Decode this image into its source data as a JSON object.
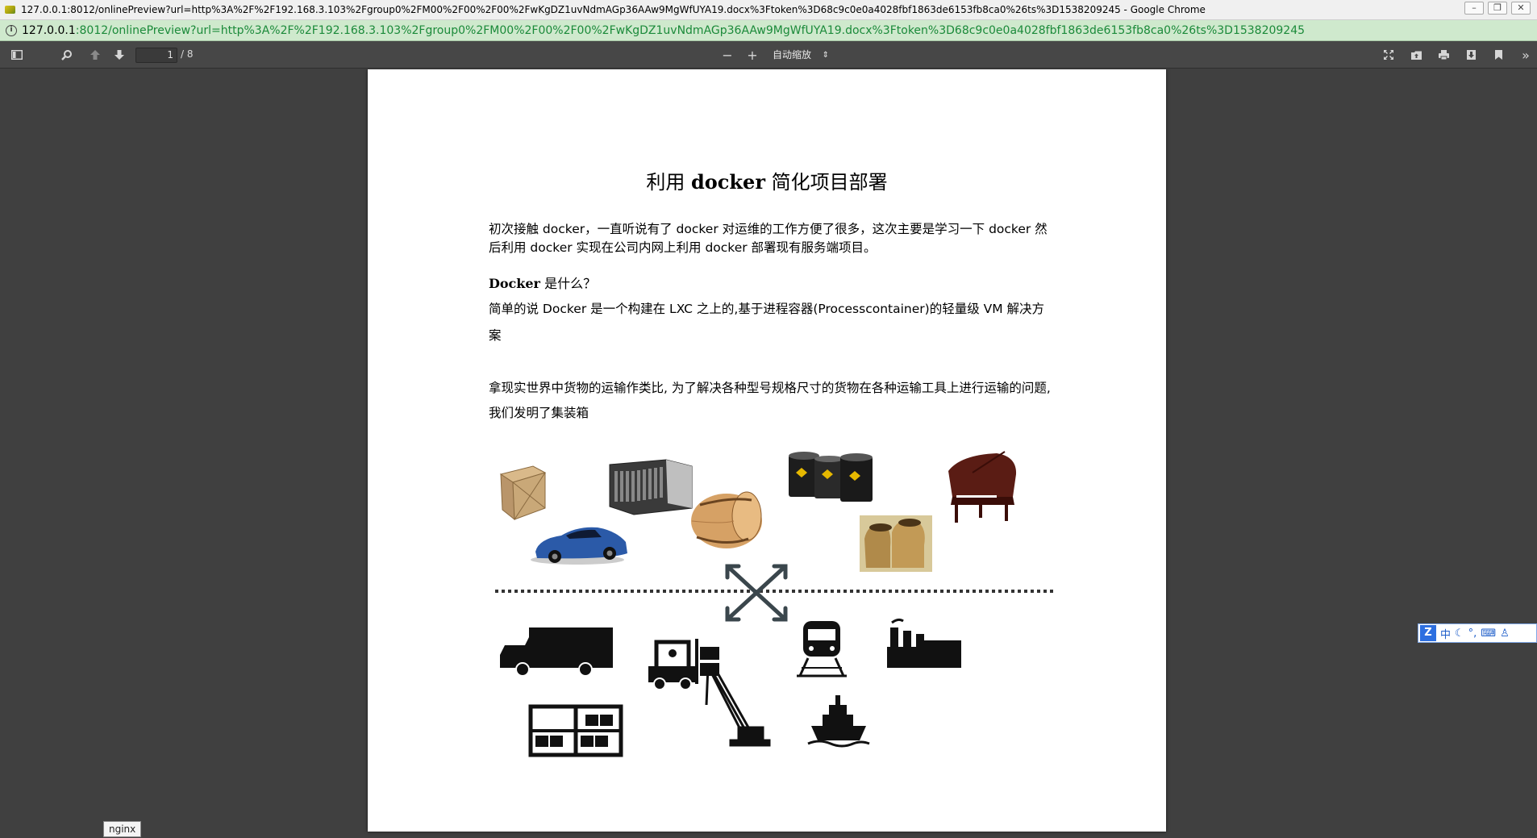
{
  "window": {
    "title": "127.0.0.1:8012/onlinePreview?url=http%3A%2F%2F192.168.3.103%2Fgroup0%2FM00%2F00%2F00%2FwKgDZ1uvNdmAGp36AAw9MgWfUYA19.docx%3Ftoken%3D68c9c0e0a4028fbf1863de6153fb8ca0%26ts%3D1538209245 - Google Chrome"
  },
  "address": {
    "host": "127.0.0.1",
    "rest": ":8012/onlinePreview?url=http%3A%2F%2F192.168.3.103%2Fgroup0%2FM00%2F00%2F00%2FwKgDZ1uvNdmAGp36AAw9MgWfUYA19.docx%3Ftoken%3D68c9c0e0a4028fbf1863de6153fb8ca0%26ts%3D1538209245"
  },
  "toolbar": {
    "page_number": "1",
    "page_count": "/ 8",
    "zoom": "自动缩放"
  },
  "document": {
    "title_prefix": "利用 ",
    "title_bold": "docker",
    "title_suffix": " 简化项目部署",
    "intro": "初次接触 docker，一直听说有了 docker 对运维的工作方便了很多，这次主要是学习一下 docker 然后利用 docker 实现在公司内网上利用 docker 部署现有服务端项目。",
    "heading_bold": "Docker",
    "heading_rest": " 是什么？",
    "para1": "简单的说 Docker 是一个构建在 LXC 之上的,基于进程容器(Processcontainer)的轻量级 VM 解决方案",
    "para2": "拿现实世界中货物的运输作类比, 为了解决各种型号规格尺寸的货物在各种运输工具上进行运输的问题,我们发明了集装箱"
  },
  "ime": {
    "logo": "Z",
    "mode": "中"
  },
  "statusbar": {
    "hover_text": "nginx"
  }
}
